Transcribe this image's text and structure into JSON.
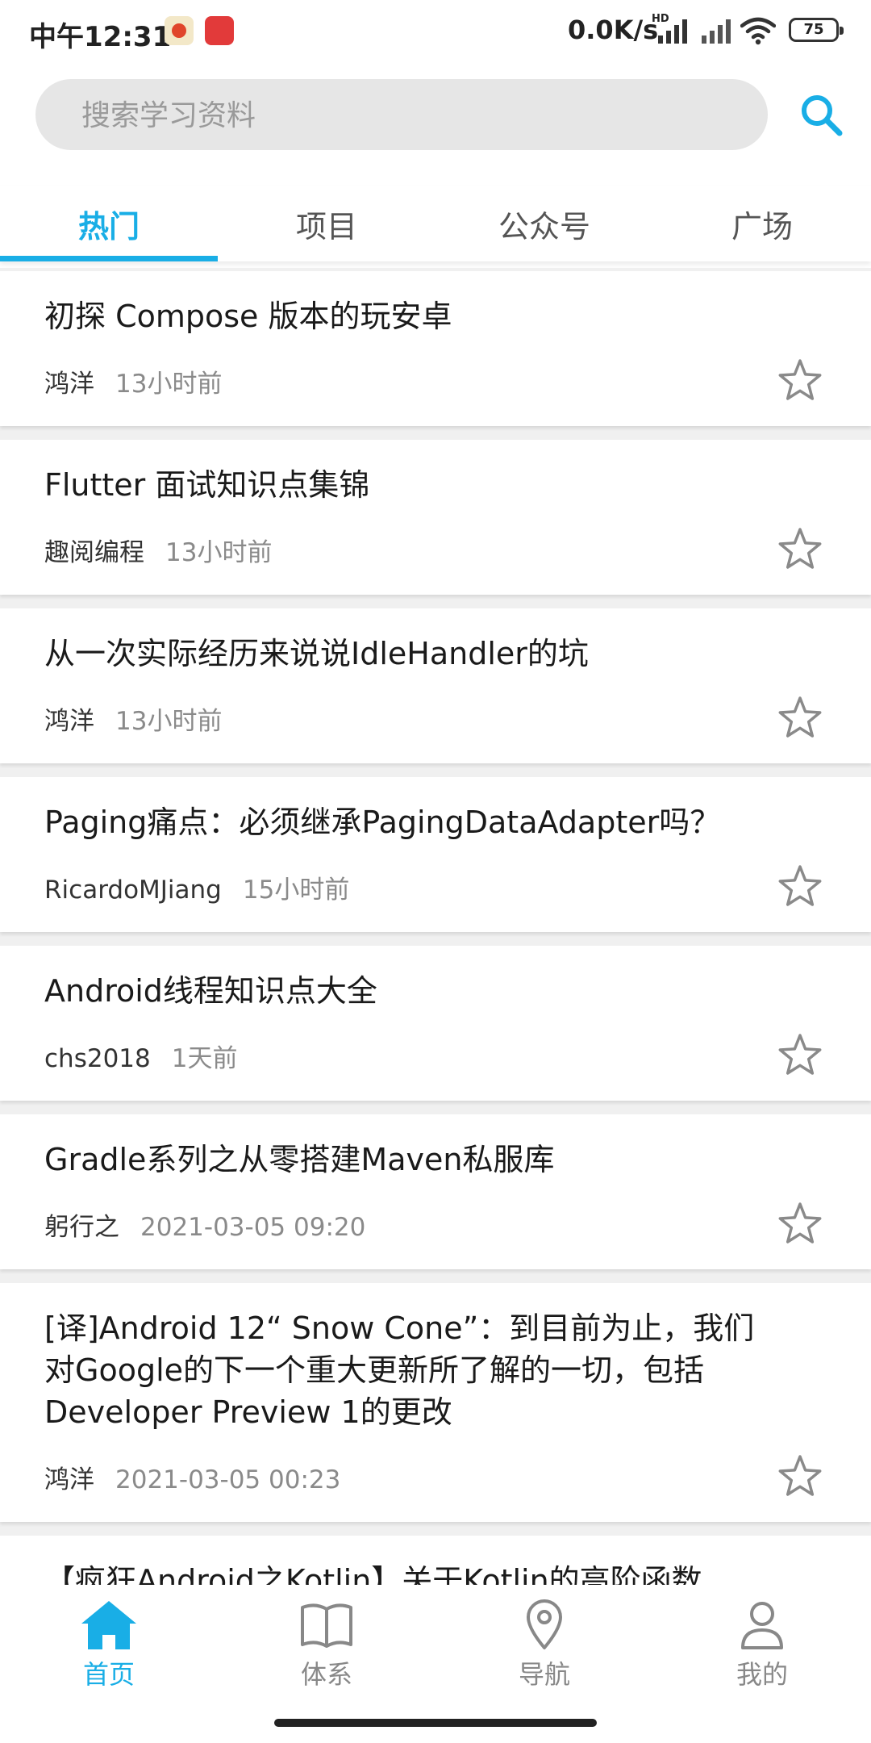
{
  "status_bar": {
    "time": "中午12:31",
    "net_speed": "0.0K/s",
    "hd_label": "HD",
    "battery": "75"
  },
  "search": {
    "placeholder": "搜索学习资料",
    "icon": "search-icon"
  },
  "tabs": [
    {
      "label": "热门",
      "active": true
    },
    {
      "label": "项目",
      "active": false
    },
    {
      "label": "公众号",
      "active": false
    },
    {
      "label": "广场",
      "active": false
    }
  ],
  "articles": [
    {
      "title": "初探 Compose 版本的玩安卓",
      "author": "鸿洋",
      "time": "13小时前"
    },
    {
      "title": "Flutter 面试知识点集锦",
      "author": "趣阅编程",
      "time": "13小时前"
    },
    {
      "title": "从一次实际经历来说说IdleHandler的坑",
      "author": "鸿洋",
      "time": "13小时前"
    },
    {
      "title": "Paging痛点：必须继承PagingDataAdapter吗？",
      "author": "RicardoMJiang",
      "time": "15小时前"
    },
    {
      "title": "Android线程知识点大全",
      "author": "chs2018",
      "time": "1天前"
    },
    {
      "title": "Gradle系列之从零搭建Maven私服库",
      "author": "躬行之",
      "time": "2021-03-05 09:20"
    },
    {
      "title": "[译]Android 12“ Snow Cone”：到目前为止，我们对Google的下一个重大更新所了解的一切，包括Developer Preview 1的更改",
      "author": "鸿洋",
      "time": "2021-03-05 00:23"
    },
    {
      "title": "【疯狂Android之Kotlin】关于Kotlin的高阶函数",
      "author": "",
      "time": ""
    }
  ],
  "bottom_nav": [
    {
      "label": "首页",
      "icon": "home-icon",
      "active": true
    },
    {
      "label": "体系",
      "icon": "book-icon",
      "active": false
    },
    {
      "label": "导航",
      "icon": "location-pin-icon",
      "active": false
    },
    {
      "label": "我的",
      "icon": "person-icon",
      "active": false
    }
  ],
  "colors": {
    "accent": "#19aee6",
    "inactive": "#888888",
    "search_bg": "#e6e6e6"
  }
}
